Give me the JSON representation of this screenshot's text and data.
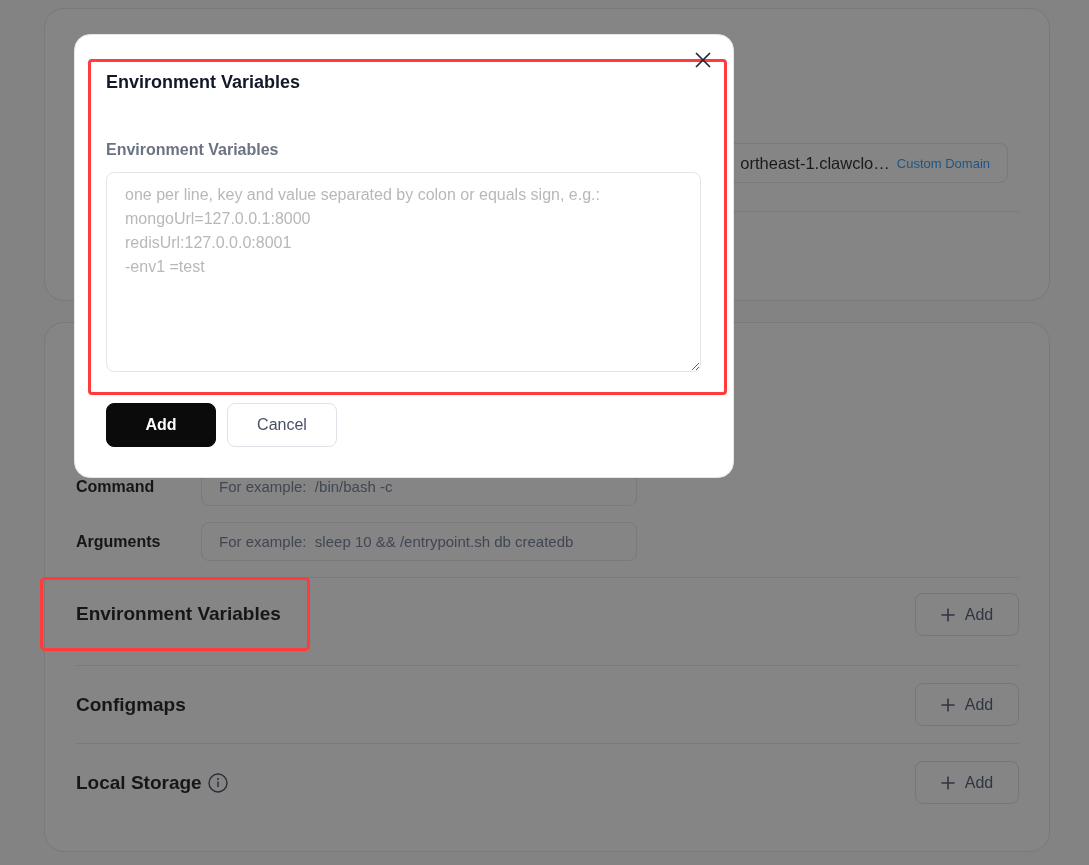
{
  "page": {
    "domain_card": {
      "domain_value": "ortheast-1.clawclo…",
      "custom_domain_link": "Custom Domain"
    },
    "settings_card": {
      "fields": [
        {
          "label": "Command",
          "placeholder": "For example:  /bin/bash -c"
        },
        {
          "label": "Arguments",
          "placeholder": "For example:  sleep 10 && /entrypoint.sh db createdb"
        }
      ],
      "sections": [
        {
          "title": "Environment Variables",
          "highlighted": true,
          "info": false,
          "button": "Add"
        },
        {
          "title": "Configmaps",
          "highlighted": false,
          "info": false,
          "button": "Add"
        },
        {
          "title": "Local Storage",
          "highlighted": false,
          "info": true,
          "button": "Add"
        }
      ]
    }
  },
  "dialog": {
    "title": "Environment Variables",
    "highlighted": true,
    "field": {
      "label": "Environment Variables",
      "placeholder": "one per line, key and value separated by colon or equals sign, e.g.:\nmongoUrl=127.0.0.1:8000\nredisUrl:127.0.0.0:8001\n-env1 =test"
    },
    "buttons": [
      {
        "label": "Add",
        "kind": "primary"
      },
      {
        "label": "Cancel",
        "kind": "secondary"
      }
    ]
  }
}
